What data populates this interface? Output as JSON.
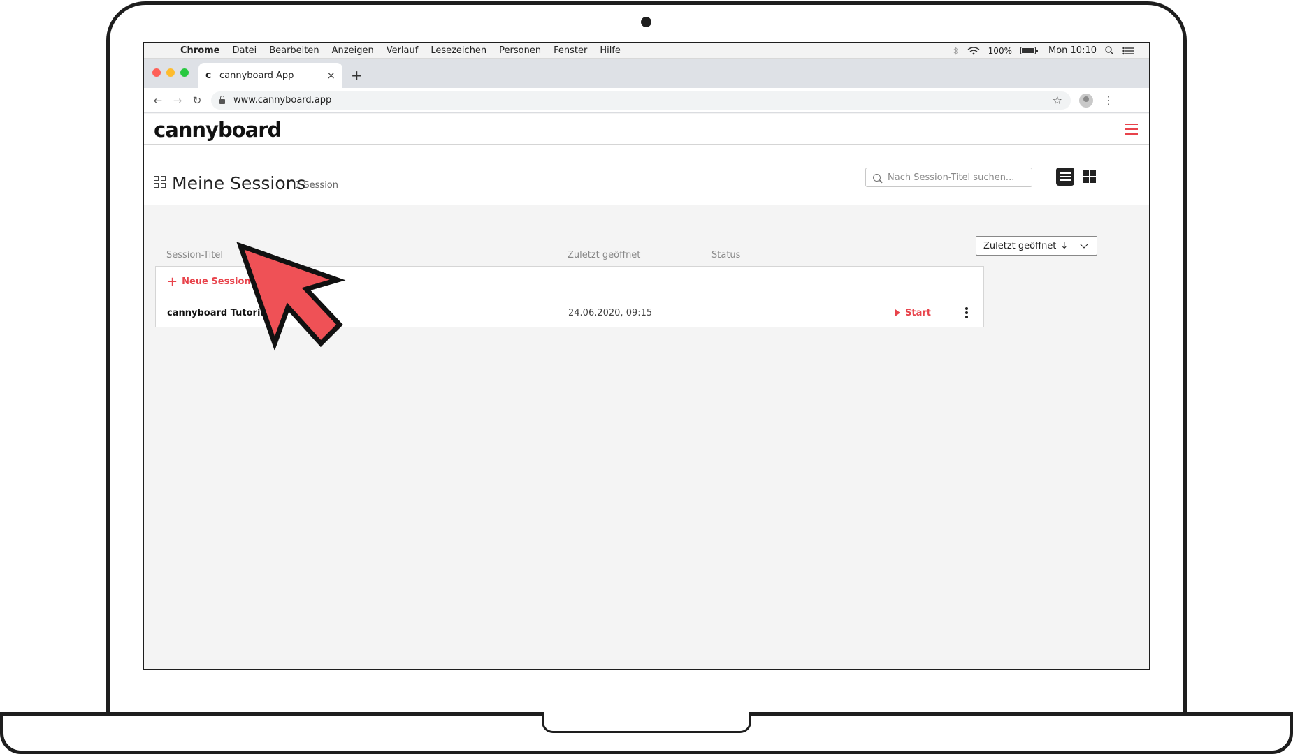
{
  "menubar": {
    "apple_icon": "apple-icon",
    "items": [
      "Chrome",
      "Datei",
      "Bearbeiten",
      "Anzeigen",
      "Verlauf",
      "Lesezeichen",
      "Personen",
      "Fenster",
      "Hilfe"
    ],
    "battery_percent": "100%",
    "clock": "Mon 10:10"
  },
  "browser": {
    "tab_favicon": "c",
    "tab_title": "cannyboard App",
    "tab_close": "×",
    "new_tab": "+",
    "back": "←",
    "forward": "→",
    "reload": "↻",
    "url": "www.cannyboard.app",
    "bookmark": "☆",
    "menu": "⋮",
    "traffic_colors": [
      "#fe5f57",
      "#febc2e",
      "#28c840"
    ]
  },
  "app": {
    "logo": "cannyboard",
    "accent": "#e8434b"
  },
  "page": {
    "title": "Meine Sessions",
    "count": "1 Session",
    "search_placeholder": "Nach Session-Titel suchen...",
    "sort_label": "Zuletzt geöffnet",
    "sort_arrow": "↓"
  },
  "table": {
    "headers": [
      "Session-Titel",
      "Zuletzt geöffnet",
      "Status"
    ],
    "new_session_label": "Neue Session erstellen",
    "rows": [
      {
        "title": "cannyboard Tutorial",
        "last_opened": "24.06.2020, 09:15",
        "action": "Start"
      }
    ]
  },
  "annotation": {
    "pointer_color": "#ef5156"
  }
}
